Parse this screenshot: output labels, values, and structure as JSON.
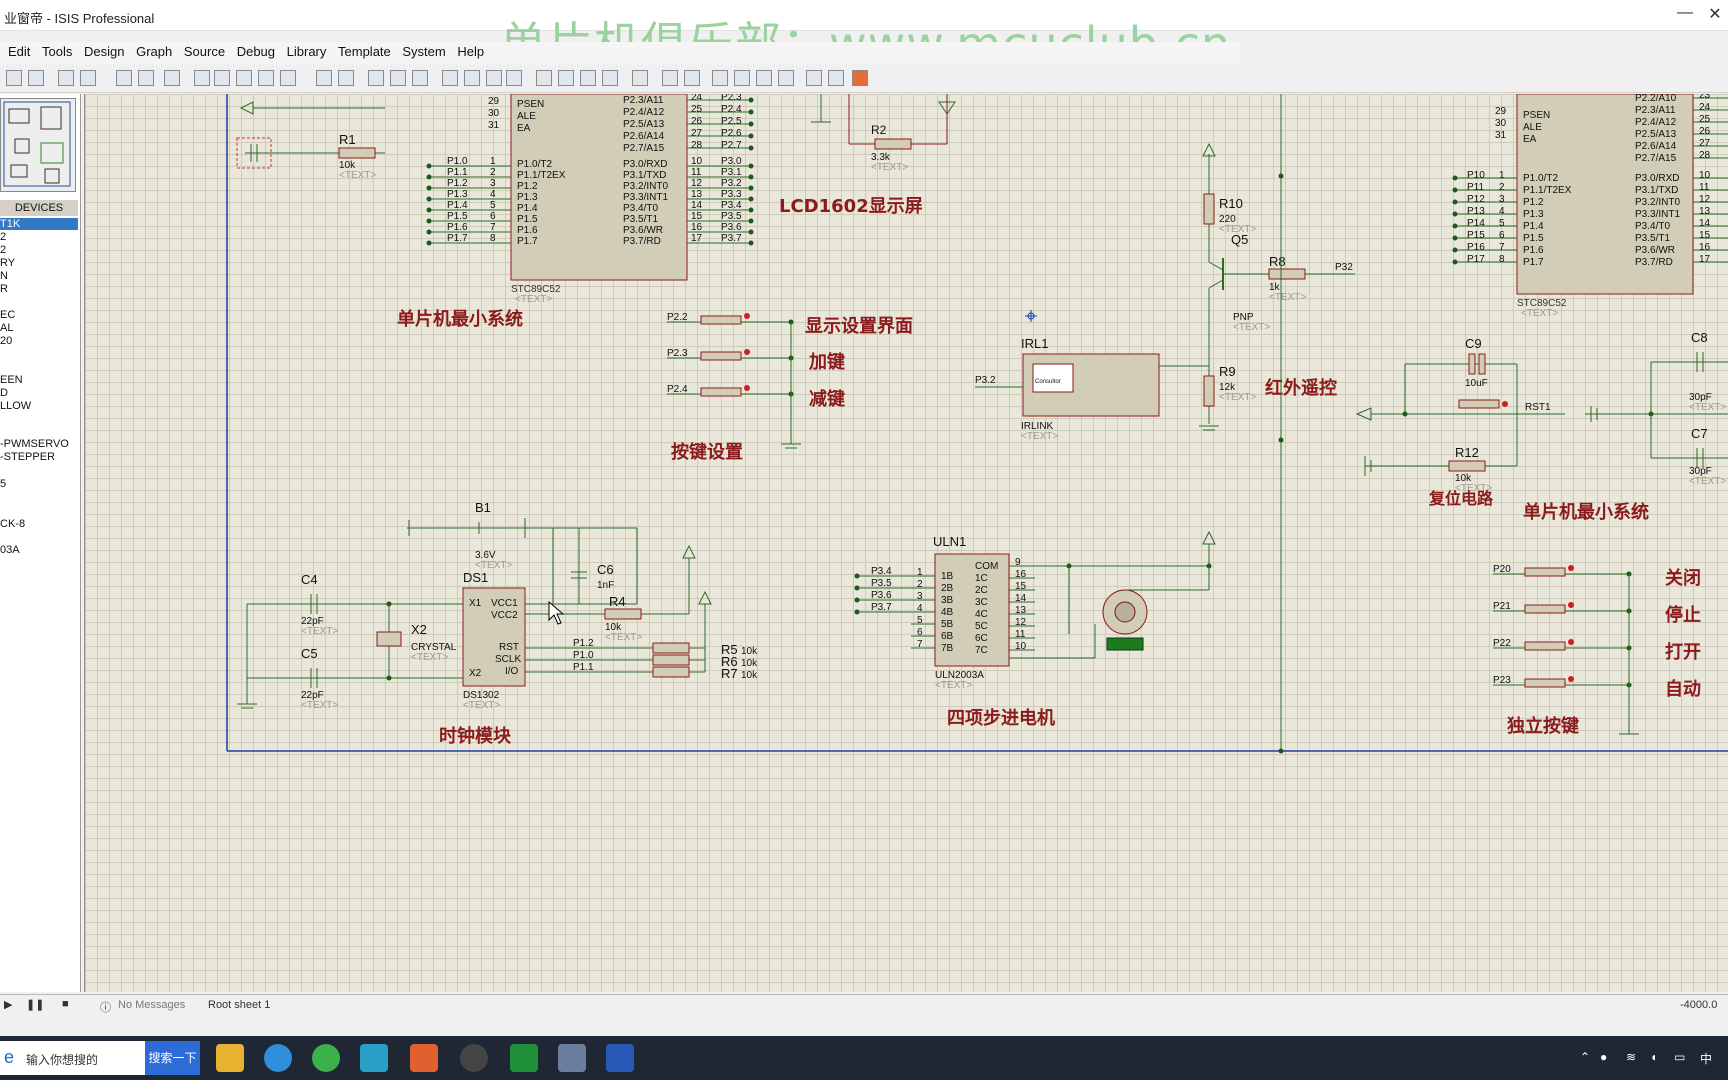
{
  "window": {
    "title": "业窗帝 - ISIS Professional",
    "watermark": "单片机俱乐部：www.mcuclub.cn",
    "minimize": "—",
    "close": "✕"
  },
  "menu": [
    "Edit",
    "Tools",
    "Design",
    "Graph",
    "Source",
    "Debug",
    "Library",
    "Template",
    "System",
    "Help"
  ],
  "devices": {
    "header": "DEVICES",
    "items": [
      "T1K",
      "2",
      "2",
      "RY",
      "N",
      "R",
      "",
      "EC",
      "AL",
      "20",
      "",
      "EEN",
      "D",
      "LLOW",
      "",
      "-PWMSERVO",
      "-STEPPER",
      "",
      "5",
      "",
      "CK-8",
      "",
      "03A"
    ]
  },
  "schematic": {
    "titles": {
      "mcu_left": "单片机最小系统",
      "lcd": "LCD1602显示屏",
      "key_settings": "按键设置",
      "display_settings": "显示设置界面",
      "plus_key": "加键",
      "minus_key": "减键",
      "ir_remote": "红外遥控",
      "clock": "时钟模块",
      "stepper": "四项步进电机",
      "reset": "复位电路",
      "mcu_right": "单片机最小系统",
      "indep_keys": "独立按键",
      "close": "关闭",
      "stop": "停止",
      "open": "打开",
      "auto": "自动"
    },
    "components": {
      "r1": {
        "ref": "R1",
        "val": "10k"
      },
      "r2": {
        "ref": "R2",
        "val": "3.3k"
      },
      "r4": {
        "ref": "R4",
        "val": "10k"
      },
      "r5": {
        "ref": "R5",
        "val": "10k"
      },
      "r6": {
        "ref": "R6",
        "val": "10k"
      },
      "r7": {
        "ref": "R7",
        "val": "10k"
      },
      "r8": {
        "ref": "R8",
        "val": "1k"
      },
      "r9": {
        "ref": "R9",
        "val": "12k"
      },
      "r10": {
        "ref": "R10",
        "val": "220"
      },
      "r12": {
        "ref": "R12",
        "val": "10k"
      },
      "q5": {
        "ref": "Q5",
        "val": "PNP"
      },
      "c4": {
        "ref": "C4",
        "val": "22pF"
      },
      "c5": {
        "ref": "C5",
        "val": "22pF"
      },
      "c6": {
        "ref": "C6",
        "val": "1nF"
      },
      "c7": {
        "ref": "C7",
        "val": "30pF"
      },
      "c8": {
        "ref": "C8",
        "val": "30pF"
      },
      "c9": {
        "ref": "C9",
        "val": "10uF"
      },
      "b1": {
        "ref": "B1",
        "val": "3.6V"
      },
      "x2": {
        "ref": "X2",
        "val": "CRYSTAL"
      },
      "ds1": {
        "ref": "DS1",
        "val": "DS1302"
      },
      "irl1": {
        "ref": "IRL1",
        "val": "IRLINK"
      },
      "uln1": {
        "ref": "ULN1",
        "val": "ULN2003A"
      },
      "mcu1": {
        "val": "STC89C52"
      },
      "mcu2": {
        "val": "STC89C52"
      },
      "text": "<TEXT>"
    },
    "mcu_left_pins_left": [
      "P1.0",
      "P1.1",
      "P1.2",
      "P1.3",
      "P1.4",
      "P1.5",
      "P1.6",
      "P1.7"
    ],
    "mcu_left_pins_inner": [
      "P1.0/T2",
      "P1.1/T2EX",
      "P1.2",
      "P1.3",
      "P1.4",
      "P1.5",
      "P1.6",
      "P1.7"
    ],
    "mcu_left_p3": [
      "P3.0/RXD",
      "P3.1/TXD",
      "P3.2/INT0",
      "P3.3/INT1",
      "P3.4/T0",
      "P3.5/T1",
      "P3.6/WR",
      "P3.7/RD"
    ],
    "mcu_left_p3_labels": [
      "P3.0",
      "P3.1",
      "P3.2",
      "P3.3",
      "P3.4",
      "P3.5",
      "P3.6",
      "P3.7"
    ],
    "mcu_left_p2": [
      "P2.3/A11",
      "P2.4/A12",
      "P2.5/A13",
      "P2.6/A14",
      "P2.7/A15"
    ],
    "mcu_left_p2_labels": [
      "P2.3",
      "P2.4",
      "P2.5",
      "P2.6",
      "P2.7"
    ],
    "mcu_left_ctl": [
      "PSEN",
      "ALE",
      "EA"
    ],
    "mcu_right_p2": [
      "P2.2/A10",
      "P2.3/A11",
      "P2.4/A12",
      "P2.5/A13",
      "P2.6/A14",
      "P2.7/A15"
    ],
    "mcu_right_p3": [
      "P3.0/RXD",
      "P3.1/TXD",
      "P3.2/INT0",
      "P3.3/INT1",
      "P3.4/T0",
      "P3.5/T1",
      "P3.6/WR",
      "P3.7/RD"
    ],
    "mcu_right_p1": [
      "P10",
      "P11",
      "P12",
      "P13",
      "P14",
      "P15",
      "P16",
      "P17"
    ],
    "key_net_labels": [
      "P2.2",
      "P2.3",
      "P2.4"
    ],
    "indep_key_labels": [
      "P20",
      "P21",
      "P22",
      "P23"
    ],
    "uln_inputs": [
      "P3.4",
      "P3.5",
      "P3.6",
      "P3.7"
    ],
    "uln_pins_left": [
      "1B",
      "2B",
      "3B",
      "4B",
      "5B",
      "6B",
      "7B"
    ],
    "uln_pins_right": [
      "COM",
      "1C",
      "2C",
      "3C",
      "4C",
      "5C",
      "6C",
      "7C"
    ],
    "ds_pins": [
      "X1",
      "X2",
      "VCC1",
      "VCC2",
      "RST",
      "SCLK",
      "I/O"
    ],
    "ds_nets": [
      "P1.2",
      "P1.0",
      "P1.1"
    ],
    "ir_net": "P3.2",
    "q_net": "P32",
    "reset_net": "RST1",
    "irlink_label": "Consultor"
  },
  "status": {
    "messages": "No Messages",
    "sheet": "Root sheet 1",
    "coord": "-4000.0"
  },
  "taskbar": {
    "search_placeholder": "输入你想搜的",
    "search_button": "搜索一下",
    "ime": "中",
    "ie_icon": "e"
  }
}
